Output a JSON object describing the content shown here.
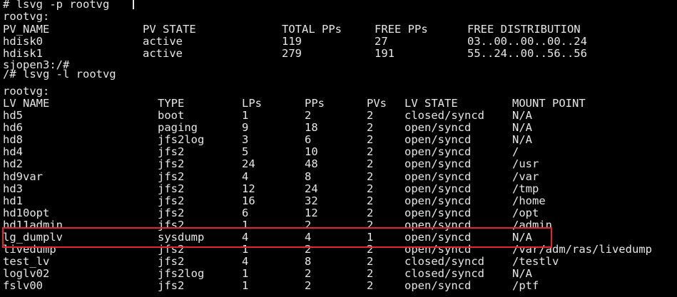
{
  "terminal": {
    "cmd1": "# lsvg -p rootvg",
    "vg_label1": "rootvg:",
    "pv_headers": [
      "PV_NAME",
      "PV STATE",
      "TOTAL PPs",
      "FREE PPs",
      "FREE DISTRIBUTION"
    ],
    "pv_rows": [
      [
        "hdisk0",
        "active",
        "119",
        "27",
        "03..00..00..00..24"
      ],
      [
        "hdisk1",
        "active",
        "279",
        "191",
        "55..24..00..56..56"
      ]
    ],
    "prompt": "sjopen3:/#",
    "cmd2": "/# lsvg -l rootvg",
    "vg_label2": "rootvg:",
    "lv_headers": [
      "LV NAME",
      "TYPE",
      "LPs",
      "PPs",
      "PVs",
      "LV STATE",
      "MOUNT POINT"
    ],
    "lv_rows": [
      [
        "hd5",
        "boot",
        "1",
        "2",
        "2",
        "closed/syncd",
        "N/A"
      ],
      [
        "hd6",
        "paging",
        "9",
        "18",
        "2",
        "open/syncd",
        "N/A"
      ],
      [
        "hd8",
        "jfs2log",
        "3",
        "6",
        "2",
        "open/syncd",
        "N/A"
      ],
      [
        "hd4",
        "jfs2",
        "5",
        "10",
        "2",
        "open/syncd",
        "/"
      ],
      [
        "hd2",
        "jfs2",
        "24",
        "48",
        "2",
        "open/syncd",
        "/usr"
      ],
      [
        "hd9var",
        "jfs2",
        "4",
        "8",
        "2",
        "open/syncd",
        "/var"
      ],
      [
        "hd3",
        "jfs2",
        "12",
        "24",
        "2",
        "open/syncd",
        "/tmp"
      ],
      [
        "hd1",
        "jfs2",
        "16",
        "32",
        "2",
        "open/syncd",
        "/home"
      ],
      [
        "hd10opt",
        "jfs2",
        "6",
        "12",
        "2",
        "open/syncd",
        "/opt"
      ],
      [
        "hd11admin",
        "jfs2",
        "1",
        "2",
        "2",
        "open/syncd",
        "/admin"
      ],
      [
        "lg_dumplv",
        "sysdump",
        "4",
        "4",
        "1",
        "open/syncd",
        "N/A"
      ],
      [
        "livedump",
        "jfs2",
        "1",
        "2",
        "2",
        "open/syncd",
        "/var/adm/ras/livedump"
      ],
      [
        "test_lv",
        "jfs2",
        "4",
        "8",
        "2",
        "closed/syncd",
        "/testlv"
      ],
      [
        "loglv02",
        "jfs2log",
        "1",
        "2",
        "2",
        "closed/syncd",
        "N/A"
      ],
      [
        "fslv00",
        "jfs2",
        "1",
        "2",
        "2",
        "open/syncd",
        "/ptf"
      ]
    ],
    "highlighted_row": "lg_dumplv",
    "highlight_color": "#e8232b",
    "text_color": "#e6e6e6",
    "background_color": "#000000"
  }
}
